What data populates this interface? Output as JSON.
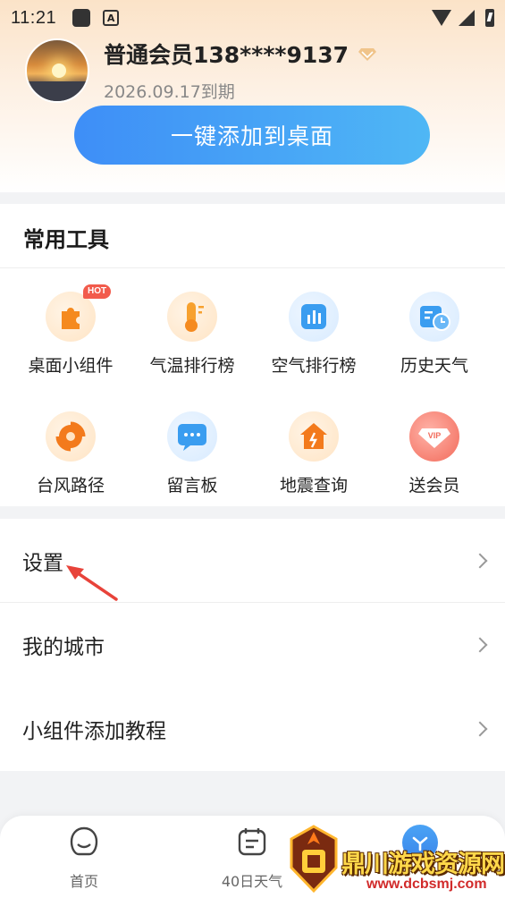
{
  "status_bar": {
    "time": "11:21",
    "icons": [
      "notification-square-icon",
      "a-badge-icon",
      "wifi-icon",
      "signal-icon",
      "battery-charging-icon"
    ]
  },
  "profile": {
    "member_name": "普通会员138****9137",
    "expire_text": "2026.09.17到期",
    "badge_icon": "diamond-icon",
    "badge_color": "#f0c48a"
  },
  "add_button": {
    "label": "一键添加到桌面",
    "color_start": "#3e8ef7",
    "color_end": "#4fb7f5"
  },
  "tools": {
    "title": "常用工具",
    "items": [
      {
        "label": "桌面小组件",
        "icon": "puzzle-icon",
        "badge": "HOT"
      },
      {
        "label": "气温排行榜",
        "icon": "thermometer-icon"
      },
      {
        "label": "空气排行榜",
        "icon": "air-chart-icon"
      },
      {
        "label": "历史天气",
        "icon": "history-clock-icon"
      },
      {
        "label": "台风路径",
        "icon": "typhoon-icon"
      },
      {
        "label": "留言板",
        "icon": "message-board-icon"
      },
      {
        "label": "地震查询",
        "icon": "earthquake-icon"
      },
      {
        "label": "送会员",
        "icon": "vip-gift-icon"
      }
    ]
  },
  "settings_list": [
    {
      "label": "设置"
    },
    {
      "label": "我的城市"
    },
    {
      "label": "小组件添加教程"
    }
  ],
  "bottom_nav": [
    {
      "label": "首页",
      "icon": "home-face-icon"
    },
    {
      "label": "40日天气",
      "icon": "calendar-icon"
    },
    {
      "label": "",
      "icon": "profile-active-icon"
    }
  ],
  "watermark": {
    "text": "鼎川游戏资源网",
    "url": "www.dcbsmj.com"
  }
}
